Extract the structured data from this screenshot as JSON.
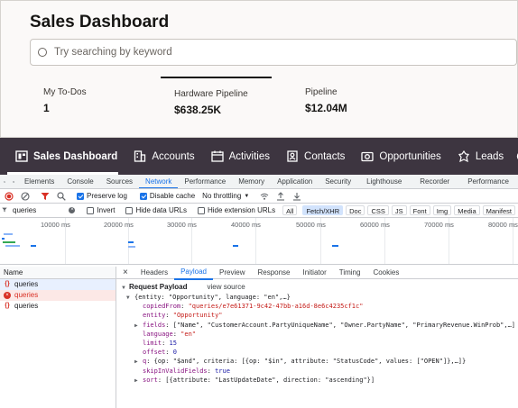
{
  "app": {
    "title": "Sales Dashboard",
    "search_placeholder": "Try searching by keyword",
    "metrics": [
      {
        "label": "My To-Dos",
        "value": "1"
      },
      {
        "label": "Hardware Pipeline",
        "value": "$638.25K"
      },
      {
        "label": "Pipeline",
        "value": "$12.04M"
      }
    ]
  },
  "nav": {
    "items": [
      "Sales Dashboard",
      "Accounts",
      "Activities",
      "Contacts",
      "Opportunities",
      "Leads"
    ]
  },
  "devtools": {
    "tabs": [
      "Elements",
      "Console",
      "Sources",
      "Network",
      "Performance",
      "Memory",
      "Application",
      "Security",
      "Lighthouse",
      "Recorder",
      "Performance"
    ],
    "toolbar": {
      "preserve_log": "Preserve log",
      "disable_cache": "Disable cache",
      "throttling": "No throttling"
    },
    "filter": {
      "value": "queries",
      "invert": "Invert",
      "hide_data_urls": "Hide data URLs",
      "hide_ext_urls": "Hide extension URLs",
      "types": [
        "All",
        "Fetch/XHR",
        "Doc",
        "CSS",
        "JS",
        "Font",
        "Img",
        "Media",
        "Manifest"
      ]
    },
    "timeline_ticks": [
      "10000 ms",
      "20000 ms",
      "30000 ms",
      "40000 ms",
      "50000 ms",
      "60000 ms",
      "70000 ms",
      "80000 ms"
    ],
    "requests": {
      "header": "Name",
      "items": [
        "queries",
        "queries",
        "queries"
      ]
    },
    "detail_tabs": [
      "Headers",
      "Payload",
      "Preview",
      "Response",
      "Initiator",
      "Timing",
      "Cookies"
    ],
    "payload": {
      "title": "Request Payload",
      "view_source": "view source",
      "summary": "{entity: \"Opportunity\", language: \"en\",…}",
      "copiedFrom_key": "copiedFrom",
      "copiedFrom_val": "\"queries/e7e61371-9c42-47bb-a16d-8e6c4235cf1c\"",
      "entity_key": "entity",
      "entity_val": "\"Opportunity\"",
      "fields_key": "fields",
      "fields_val": "[\"Name\", \"CustomerAccount.PartyUniqueName\", \"Owner.PartyName\", \"PrimaryRevenue.WinProb\",…]",
      "language_key": "language",
      "language_val": "\"en\"",
      "limit_key": "limit",
      "limit_val": "15",
      "offset_key": "offset",
      "offset_val": "0",
      "q_key": "q",
      "q_val": "{op: \"$and\", criteria: [{op: \"$in\", attribute: \"StatusCode\", values: [\"OPEN\"]},…]}",
      "skip_key": "skipInValidFields",
      "skip_val": "true",
      "sort_key": "sort",
      "sort_val": "[{attribute: \"LastUpdateDate\", direction: \"ascending\"}]"
    }
  }
}
